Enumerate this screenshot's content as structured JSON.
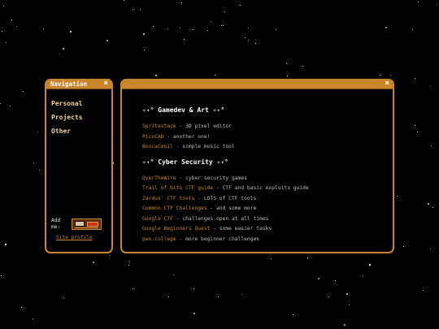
{
  "colors": {
    "accent": "#c8852b",
    "background": "#000000",
    "text": "#bdbdbd",
    "link": "#c8852b"
  },
  "nav": {
    "title": "Navigation",
    "close_icon": "close-icon",
    "links": [
      "Personal",
      "Projects",
      "Other"
    ],
    "add_me": "Add me:",
    "site_profile": "Site profile",
    "badge_icon": "88x31-button-icon"
  },
  "main": {
    "close_icon": "close-icon",
    "sections": [
      {
        "heading": "✧˖° Gamedev & Art ✧˖°",
        "items": [
          {
            "link": "Spritestack",
            "desc": " - 3D pixel editor"
          },
          {
            "link": "PicoCAD",
            "desc": " - another one!"
          },
          {
            "link": "BoscaCeoil",
            "desc": " - simple music tool"
          }
        ]
      },
      {
        "heading": "✧˖° Cyber Security ✧˖°",
        "items": [
          {
            "link": "OverTheWire",
            "desc": " - cyber security games"
          },
          {
            "link": "Trail of bits CTF guide",
            "desc": " - CTF and basic exploits guide"
          },
          {
            "link": "Zardus' CTF tools",
            "desc": " - LOTS of CTF tools"
          },
          {
            "link": "Common CTF Challenges",
            "desc": " - and some more"
          },
          {
            "link": "Google CTF",
            "desc": " - challenges open at all times"
          },
          {
            "link": "Google Beginners Quest",
            "desc": " - some easier tasks"
          },
          {
            "link": "pwn.college",
            "desc": " - more beginner challenges"
          }
        ]
      }
    ]
  }
}
